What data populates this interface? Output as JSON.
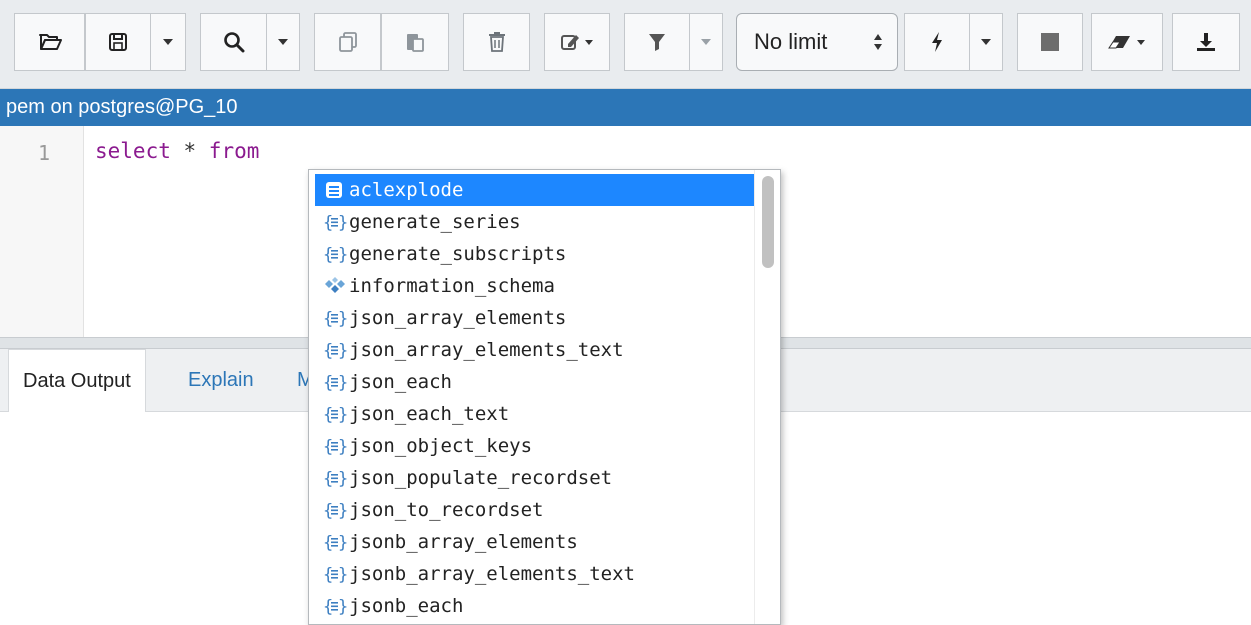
{
  "toolbar": {
    "open_file": "open-file-icon",
    "save": "save-icon",
    "find": "find-icon",
    "copy": "copy-icon",
    "paste": "paste-icon",
    "delete": "delete-icon",
    "edit": "edit-icon",
    "filter": "filter-icon",
    "limit_value": "No limit",
    "execute": "execute-icon",
    "stop": "stop-icon",
    "clear": "clear-icon",
    "download": "download-icon"
  },
  "connection": {
    "label": "pem on postgres@PG_10"
  },
  "editor": {
    "line_number": "1",
    "code": {
      "kw1": "select",
      "op": " * ",
      "kw2": "from"
    }
  },
  "output_tabs": {
    "data_output": "Data Output",
    "explain": "Explain",
    "messages_partial": "M"
  },
  "autocomplete": {
    "items": [
      {
        "label": "aclexplode",
        "icon": "table-function-icon",
        "selected": true
      },
      {
        "label": "generate_series",
        "icon": "function-icon"
      },
      {
        "label": "generate_subscripts",
        "icon": "function-icon"
      },
      {
        "label": "information_schema",
        "icon": "schema-icon"
      },
      {
        "label": "json_array_elements",
        "icon": "function-icon"
      },
      {
        "label": "json_array_elements_text",
        "icon": "function-icon"
      },
      {
        "label": "json_each",
        "icon": "function-icon"
      },
      {
        "label": "json_each_text",
        "icon": "function-icon"
      },
      {
        "label": "json_object_keys",
        "icon": "function-icon"
      },
      {
        "label": "json_populate_recordset",
        "icon": "function-icon"
      },
      {
        "label": "json_to_recordset",
        "icon": "function-icon"
      },
      {
        "label": "jsonb_array_elements",
        "icon": "function-icon"
      },
      {
        "label": "jsonb_array_elements_text",
        "icon": "function-icon"
      },
      {
        "label": "jsonb_each",
        "icon": "function-icon"
      }
    ]
  },
  "colors": {
    "connection_bar": "#2c76b7",
    "selected_item": "#1d87ff",
    "keyword": "#8b1a8f"
  }
}
